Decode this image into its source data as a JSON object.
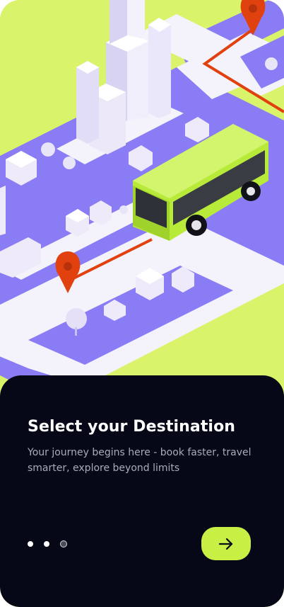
{
  "onboarding": {
    "title": "Select your Destination",
    "subtitle": "Your journey begins here - book faster, travel smarter, explore beyond limits",
    "pagination": {
      "total": 3,
      "current": 3
    },
    "next_icon": "arrow-right-icon"
  },
  "illustration": {
    "name": "isometric-city-bus-route",
    "colors": {
      "background": "#d9f36a",
      "ground": "#8a7cf5",
      "road": "#ffffff",
      "bus": "#b8ea3a",
      "route": "#e0410f",
      "building": "#ece8f8"
    }
  },
  "theme": {
    "sheet": "#060818",
    "accent": "#c8f044",
    "title_color": "#ffffff",
    "subtitle_color": "#a9acb8"
  }
}
